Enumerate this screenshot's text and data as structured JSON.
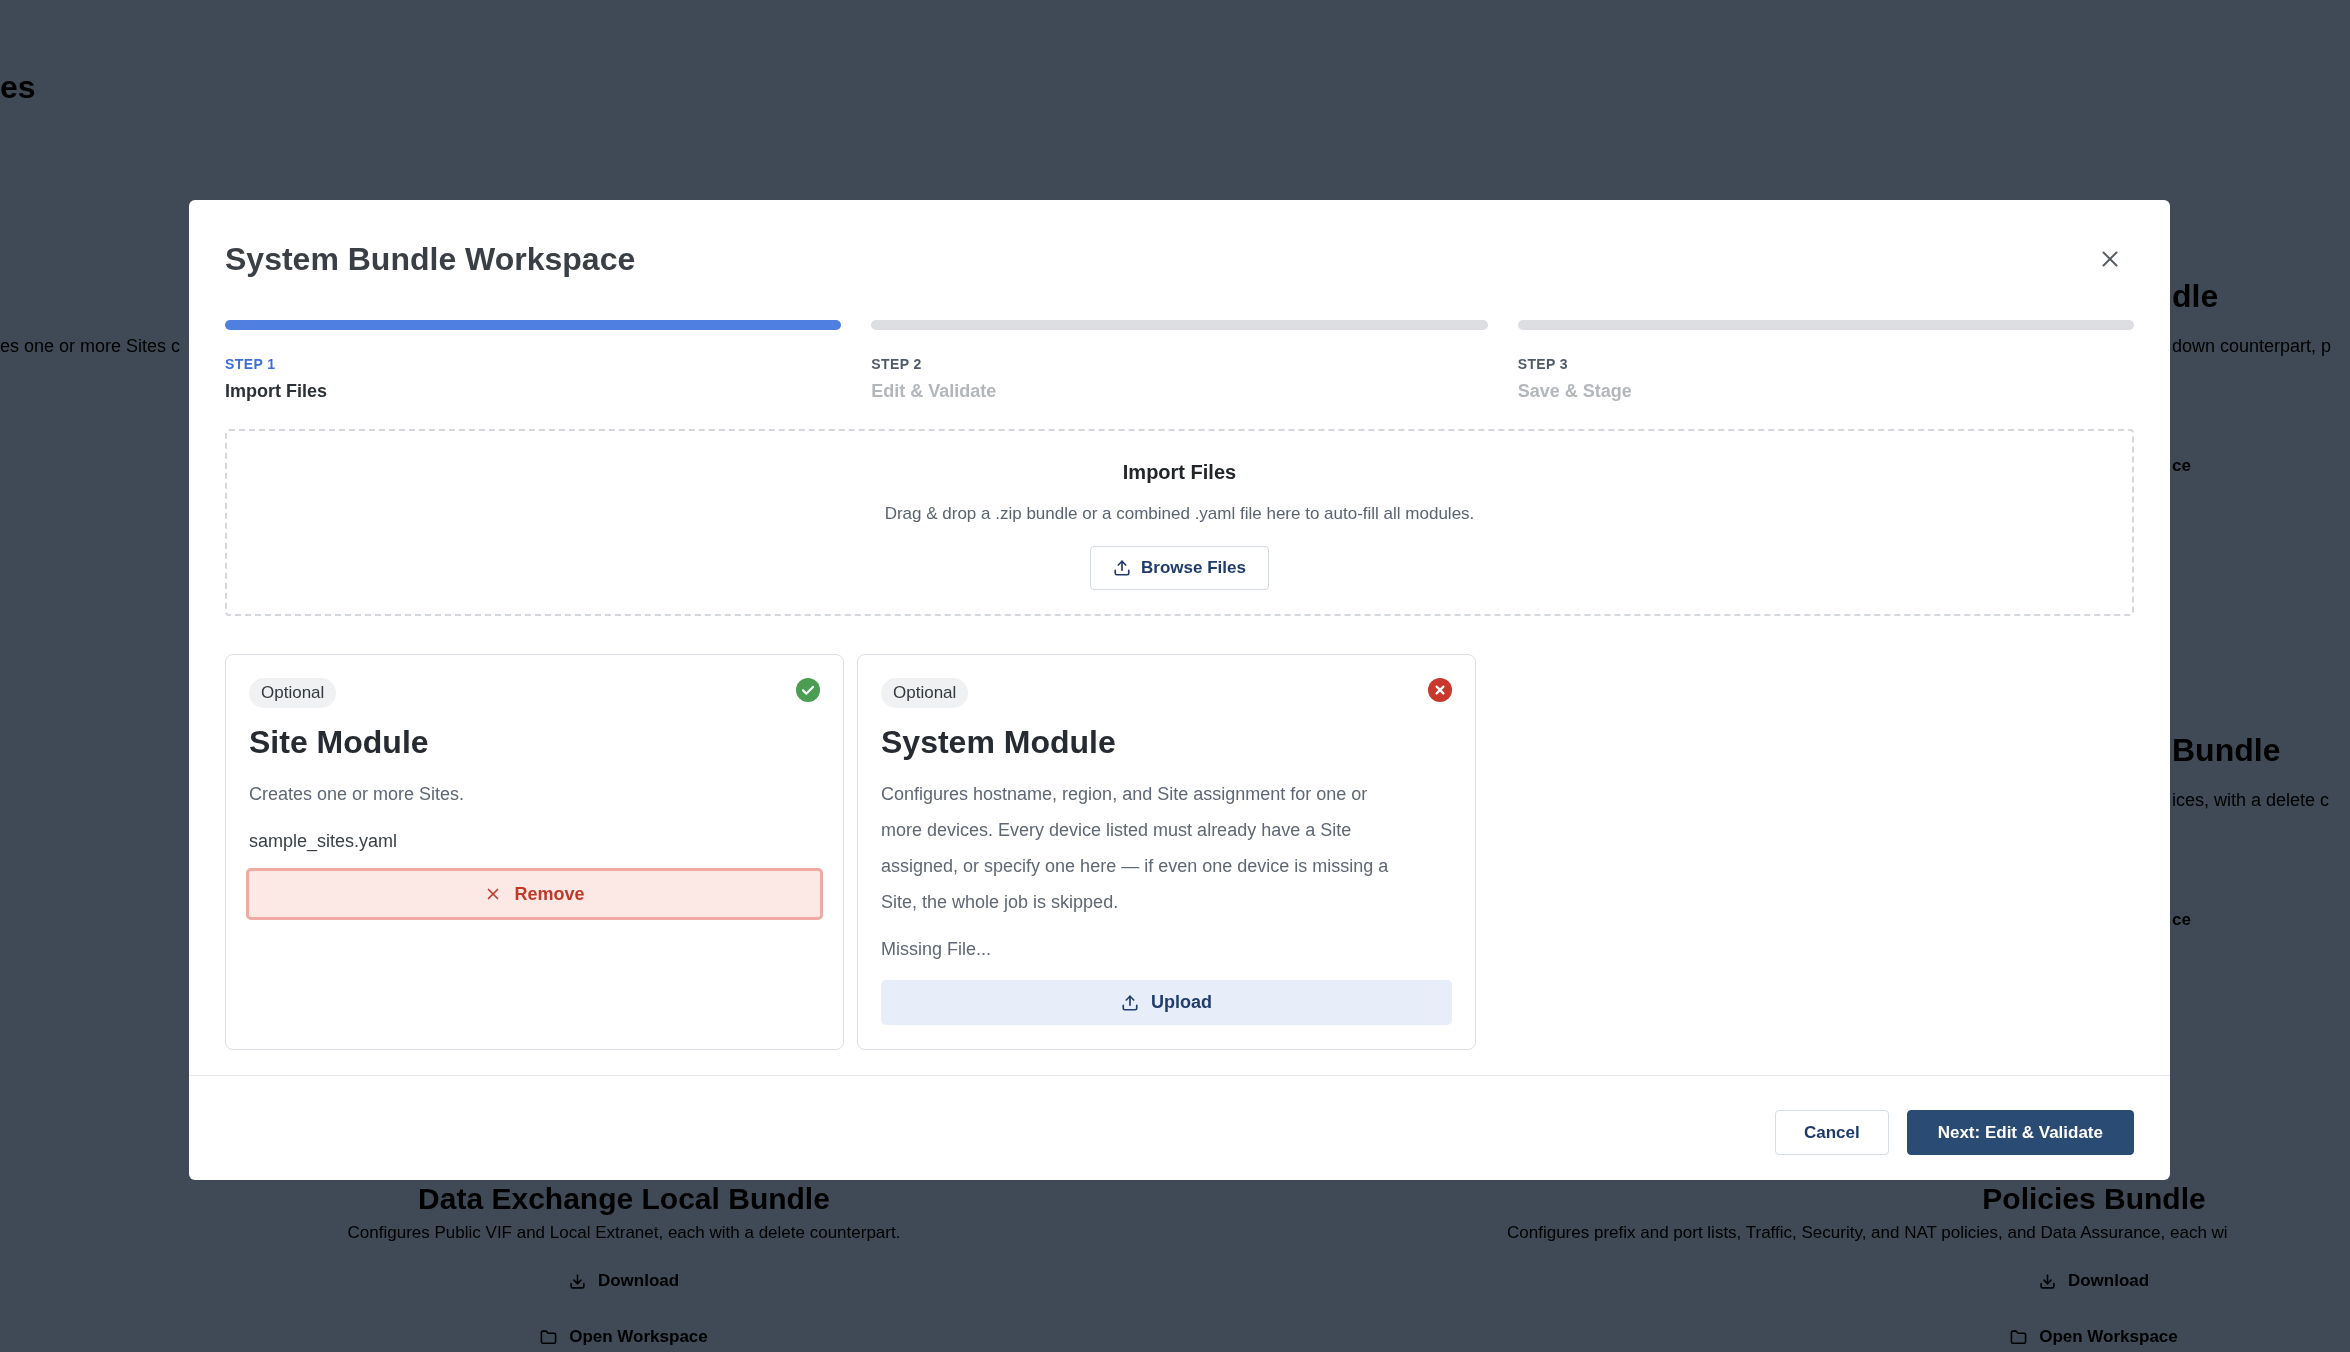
{
  "background": {
    "heading": "es",
    "left_column": [
      {
        "description": "es one or more Sites c"
      }
    ],
    "right_column": [
      {
        "title": "dle",
        "description": "down counterpart, p",
        "action": "ce"
      },
      {
        "title": "Bundle",
        "description": "ices, with a delete c",
        "action": "ce"
      }
    ],
    "bottom_row": [
      {
        "title": "Data Exchange Local Bundle",
        "description": "Configures Public VIF and Local Extranet, each with a delete counterpart.",
        "download": "Download",
        "open": "Open Workspace"
      },
      {
        "title": "Policies Bundle",
        "description": "Configures prefix and port lists, Traffic, Security, and NAT policies, and Data Assurance, each wi",
        "download": "Download",
        "open": "Open Workspace"
      }
    ]
  },
  "dialog": {
    "title": "System Bundle Workspace",
    "steps": [
      {
        "label": "STEP 1",
        "title": "Import Files",
        "selected": true
      },
      {
        "label": "STEP 2",
        "title": "Edit & Validate",
        "selected": false
      },
      {
        "label": "STEP 3",
        "title": "Save & Stage",
        "selected": false
      }
    ],
    "dropzone": {
      "title": "Import Files",
      "hint": "Drag & drop a .zip bundle or a combined .yaml file here to auto-fill all modules.",
      "button": "Browse Files"
    },
    "modules": [
      {
        "badge": "Optional",
        "valid": true,
        "title": "Site Module",
        "description": "Creates one or more Sites.",
        "file": "sample_sites.yaml",
        "file_missing": false,
        "action": {
          "kind": "remove",
          "label": "Remove"
        }
      },
      {
        "badge": "Optional",
        "valid": false,
        "title": "System Module",
        "description": "Configures hostname, region, and Site assignment for one or more devices. Every device listed must already have a Site assigned, or specify one here — if even one device is missing a Site, the whole job is skipped.",
        "file": "Missing File...",
        "file_missing": true,
        "action": {
          "kind": "upload",
          "label": "Upload"
        }
      }
    ],
    "footer_buttons": [
      {
        "kind": "secondary",
        "label": "Cancel"
      },
      {
        "kind": "primary",
        "label": "Next: Edit & Validate"
      }
    ]
  }
}
